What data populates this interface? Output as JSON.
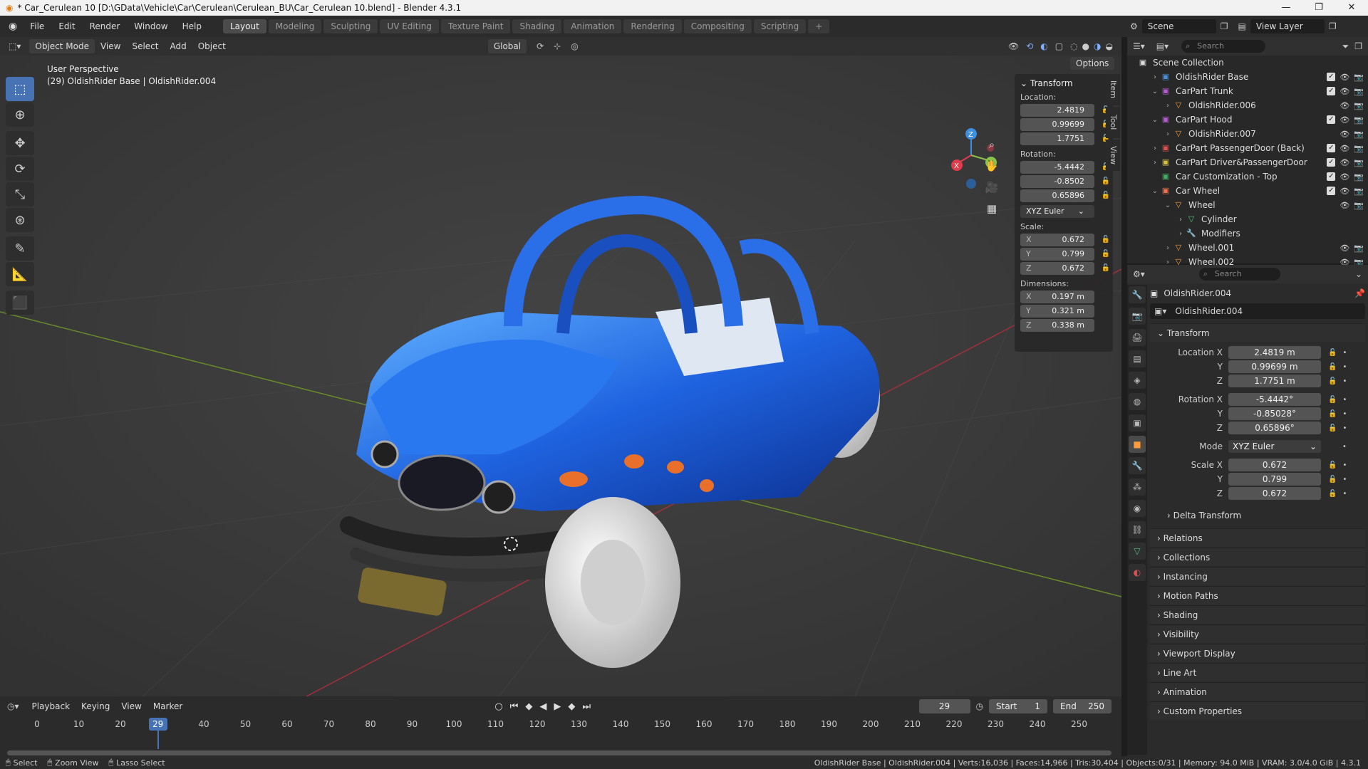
{
  "window": {
    "title": "* Car_Cerulean 10 [D:\\GData\\Vehicle\\Car\\Cerulean\\Cerulean_BU\\Car_Cerulean 10.blend] - Blender 4.3.1",
    "min": "—",
    "max": "❐",
    "close": "✕"
  },
  "menubar": {
    "menus": [
      "File",
      "Edit",
      "Render",
      "Window",
      "Help"
    ],
    "workspaces": [
      "Layout",
      "Modeling",
      "Sculpting",
      "UV Editing",
      "Texture Paint",
      "Shading",
      "Animation",
      "Rendering",
      "Compositing",
      "Scripting"
    ],
    "add_tab": "+",
    "scene": "Scene",
    "view_layer": "View Layer"
  },
  "viewport_header": {
    "mode": "Object Mode",
    "menus": [
      "View",
      "Select",
      "Add",
      "Object"
    ],
    "orientation": "Global",
    "options": "Options"
  },
  "viewport": {
    "perspective": "User Perspective",
    "context": "(29) OldishRider Base | OldishRider.004",
    "gizmo": {
      "x": "X",
      "y": "Y",
      "z": "Z"
    }
  },
  "npanel": {
    "section": "Transform",
    "location_label": "Location:",
    "location": [
      "2.4819",
      "0.99699",
      "1.7751"
    ],
    "rotation_label": "Rotation:",
    "rotation": [
      "-5.4442",
      "-0.8502",
      "0.65896"
    ],
    "rotation_mode": "XYZ Euler",
    "scale_label": "Scale:",
    "scale": [
      {
        "ax": "X",
        "v": "0.672"
      },
      {
        "ax": "Y",
        "v": "0.799"
      },
      {
        "ax": "Z",
        "v": "0.672"
      }
    ],
    "dimensions_label": "Dimensions:",
    "dimensions": [
      {
        "ax": "X",
        "v": "0.197 m"
      },
      {
        "ax": "Y",
        "v": "0.321 m"
      },
      {
        "ax": "Z",
        "v": "0.338 m"
      }
    ],
    "tabs": [
      "Item",
      "Tool",
      "View"
    ]
  },
  "timeline": {
    "menus": [
      "Playback",
      "Keying",
      "View",
      "Marker"
    ],
    "current_frame": "29",
    "start_label": "Start",
    "start": "1",
    "end_label": "End",
    "end": "250",
    "ticks": [
      "0",
      "10",
      "20",
      "30",
      "40",
      "50",
      "60",
      "70",
      "80",
      "90",
      "100",
      "110",
      "120",
      "130",
      "140",
      "150",
      "160",
      "170",
      "180",
      "190",
      "200",
      "210",
      "220",
      "230",
      "240",
      "250"
    ],
    "marker": "29"
  },
  "statusbar": {
    "select": "Select",
    "zoom": "Zoom View",
    "lasso": "Lasso Select",
    "stats": "OldishRider Base | OldishRider.004 | Verts:16,036 | Faces:14,966 | Tris:30,404 | Objects:0/31 | Memory: 94.0 MiB | VRAM: 3.0/4.0 GiB | 4.3.1"
  },
  "outliner": {
    "search_placeholder": "Search",
    "root": "Scene Collection",
    "rows": [
      {
        "name": "OldishRider Base",
        "indent": 1,
        "caret": "›",
        "kind": "coll",
        "color": "#4a8fdc"
      },
      {
        "name": "CarPart Trunk",
        "indent": 1,
        "caret": "⌄",
        "kind": "coll",
        "color": "#b45ccf"
      },
      {
        "name": "OldishRider.006",
        "indent": 2,
        "caret": "›",
        "kind": "mesh",
        "color": "#f0a040"
      },
      {
        "name": "CarPart Hood",
        "indent": 1,
        "caret": "⌄",
        "kind": "coll",
        "color": "#b45ccf"
      },
      {
        "name": "OldishRider.007",
        "indent": 2,
        "caret": "›",
        "kind": "mesh",
        "color": "#f0a040"
      },
      {
        "name": "CarPart PassengerDoor (Back)",
        "indent": 1,
        "caret": "›",
        "kind": "coll",
        "color": "#e05050"
      },
      {
        "name": "CarPart Driver&PassengerDoor",
        "indent": 1,
        "caret": "›",
        "kind": "coll",
        "color": "#d8c040"
      },
      {
        "name": "Car Customization - Top",
        "indent": 1,
        "caret": "",
        "kind": "coll",
        "color": "#40b060"
      },
      {
        "name": "Car Wheel",
        "indent": 1,
        "caret": "⌄",
        "kind": "coll",
        "color": "#f07050"
      },
      {
        "name": "Wheel",
        "indent": 2,
        "caret": "⌄",
        "kind": "mesh",
        "color": "#f0a040"
      },
      {
        "name": "Cylinder",
        "indent": 3,
        "caret": "›",
        "kind": "data",
        "color": "#50c080"
      },
      {
        "name": "Modifiers",
        "indent": 3,
        "caret": "›",
        "kind": "mod",
        "color": "#6aa0e0"
      },
      {
        "name": "Wheel.001",
        "indent": 2,
        "caret": "›",
        "kind": "mesh",
        "color": "#f0a040"
      },
      {
        "name": "Wheel.002",
        "indent": 2,
        "caret": "›",
        "kind": "mesh",
        "color": "#f0a040"
      }
    ]
  },
  "properties": {
    "search_placeholder": "Search",
    "object_name": "OldishRider.004",
    "datablock": "OldishRider.004",
    "transform_label": "Transform",
    "fields": [
      {
        "label": "Location X",
        "value": "2.4819 m"
      },
      {
        "label": "Y",
        "value": "0.99699 m"
      },
      {
        "label": "Z",
        "value": "1.7751 m"
      },
      {
        "label": "Rotation X",
        "value": "-5.4442°"
      },
      {
        "label": "Y",
        "value": "-0.85028°"
      },
      {
        "label": "Z",
        "value": "0.65896°"
      }
    ],
    "mode_label": "Mode",
    "mode_value": "XYZ Euler",
    "scale_fields": [
      {
        "label": "Scale X",
        "value": "0.672"
      },
      {
        "label": "Y",
        "value": "0.799"
      },
      {
        "label": "Z",
        "value": "0.672"
      }
    ],
    "delta": "Delta Transform",
    "sections": [
      "Relations",
      "Collections",
      "Instancing",
      "Motion Paths",
      "Shading",
      "Visibility",
      "Viewport Display",
      "Line Art",
      "Animation",
      "Custom Properties"
    ]
  },
  "colors": {
    "accent": "#4772b3",
    "object_orange": "#ff9a3c",
    "axis_x": "#e03c4c",
    "axis_y": "#8bc34a",
    "axis_z": "#3d8fe0"
  }
}
